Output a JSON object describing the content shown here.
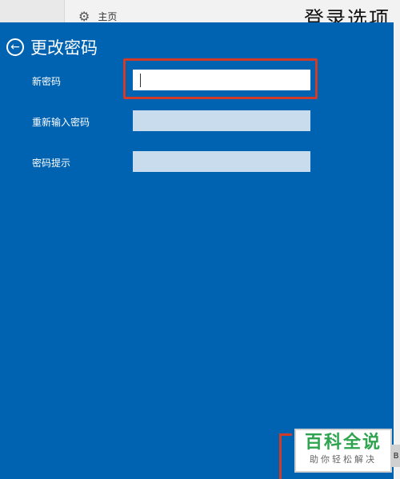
{
  "background": {
    "home_label": "主页",
    "page_title": "登录选项"
  },
  "dialog": {
    "title": "更改密码",
    "fields": [
      {
        "label": "新密码",
        "value": ""
      },
      {
        "label": "重新输入密码",
        "value": ""
      },
      {
        "label": "密码提示",
        "value": ""
      }
    ]
  },
  "watermark": {
    "main": "百科全说",
    "sub": "助你轻松解决"
  },
  "edge_button_text": "B",
  "colors": {
    "dialog_bg": "#0063b1",
    "highlight": "#d23b28",
    "watermark_green": "#2ea44f"
  }
}
